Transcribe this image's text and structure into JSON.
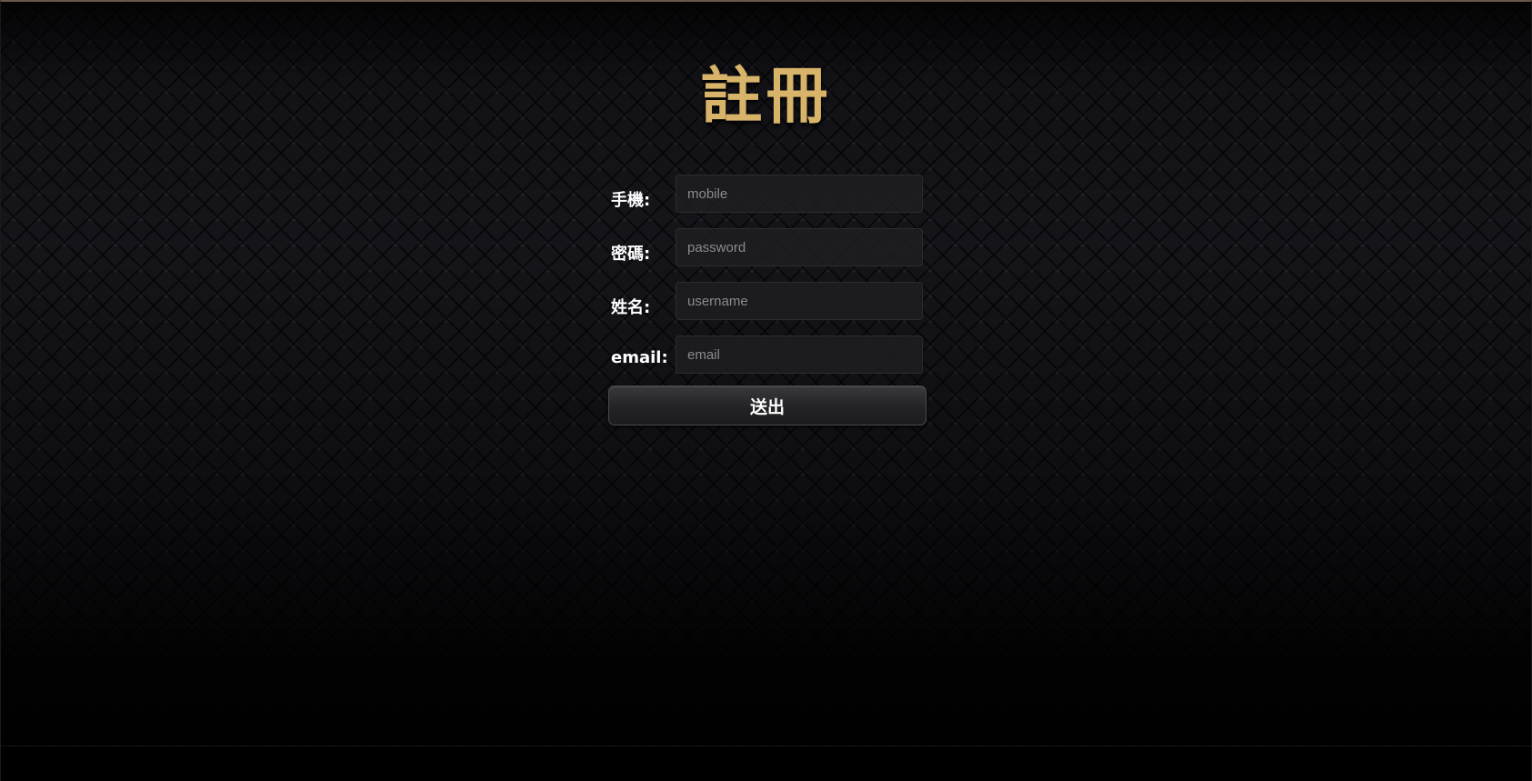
{
  "page": {
    "title": "註冊"
  },
  "form": {
    "fields": [
      {
        "label": "手機:",
        "placeholder": "mobile"
      },
      {
        "label": "密碼:",
        "placeholder": "password"
      },
      {
        "label": "姓名:",
        "placeholder": "username"
      },
      {
        "label": "email:",
        "placeholder": "email"
      }
    ],
    "submit_label": "送出"
  },
  "colors": {
    "title": "#d8b46a",
    "label": "#ffffff",
    "background": "#1b1b22"
  }
}
